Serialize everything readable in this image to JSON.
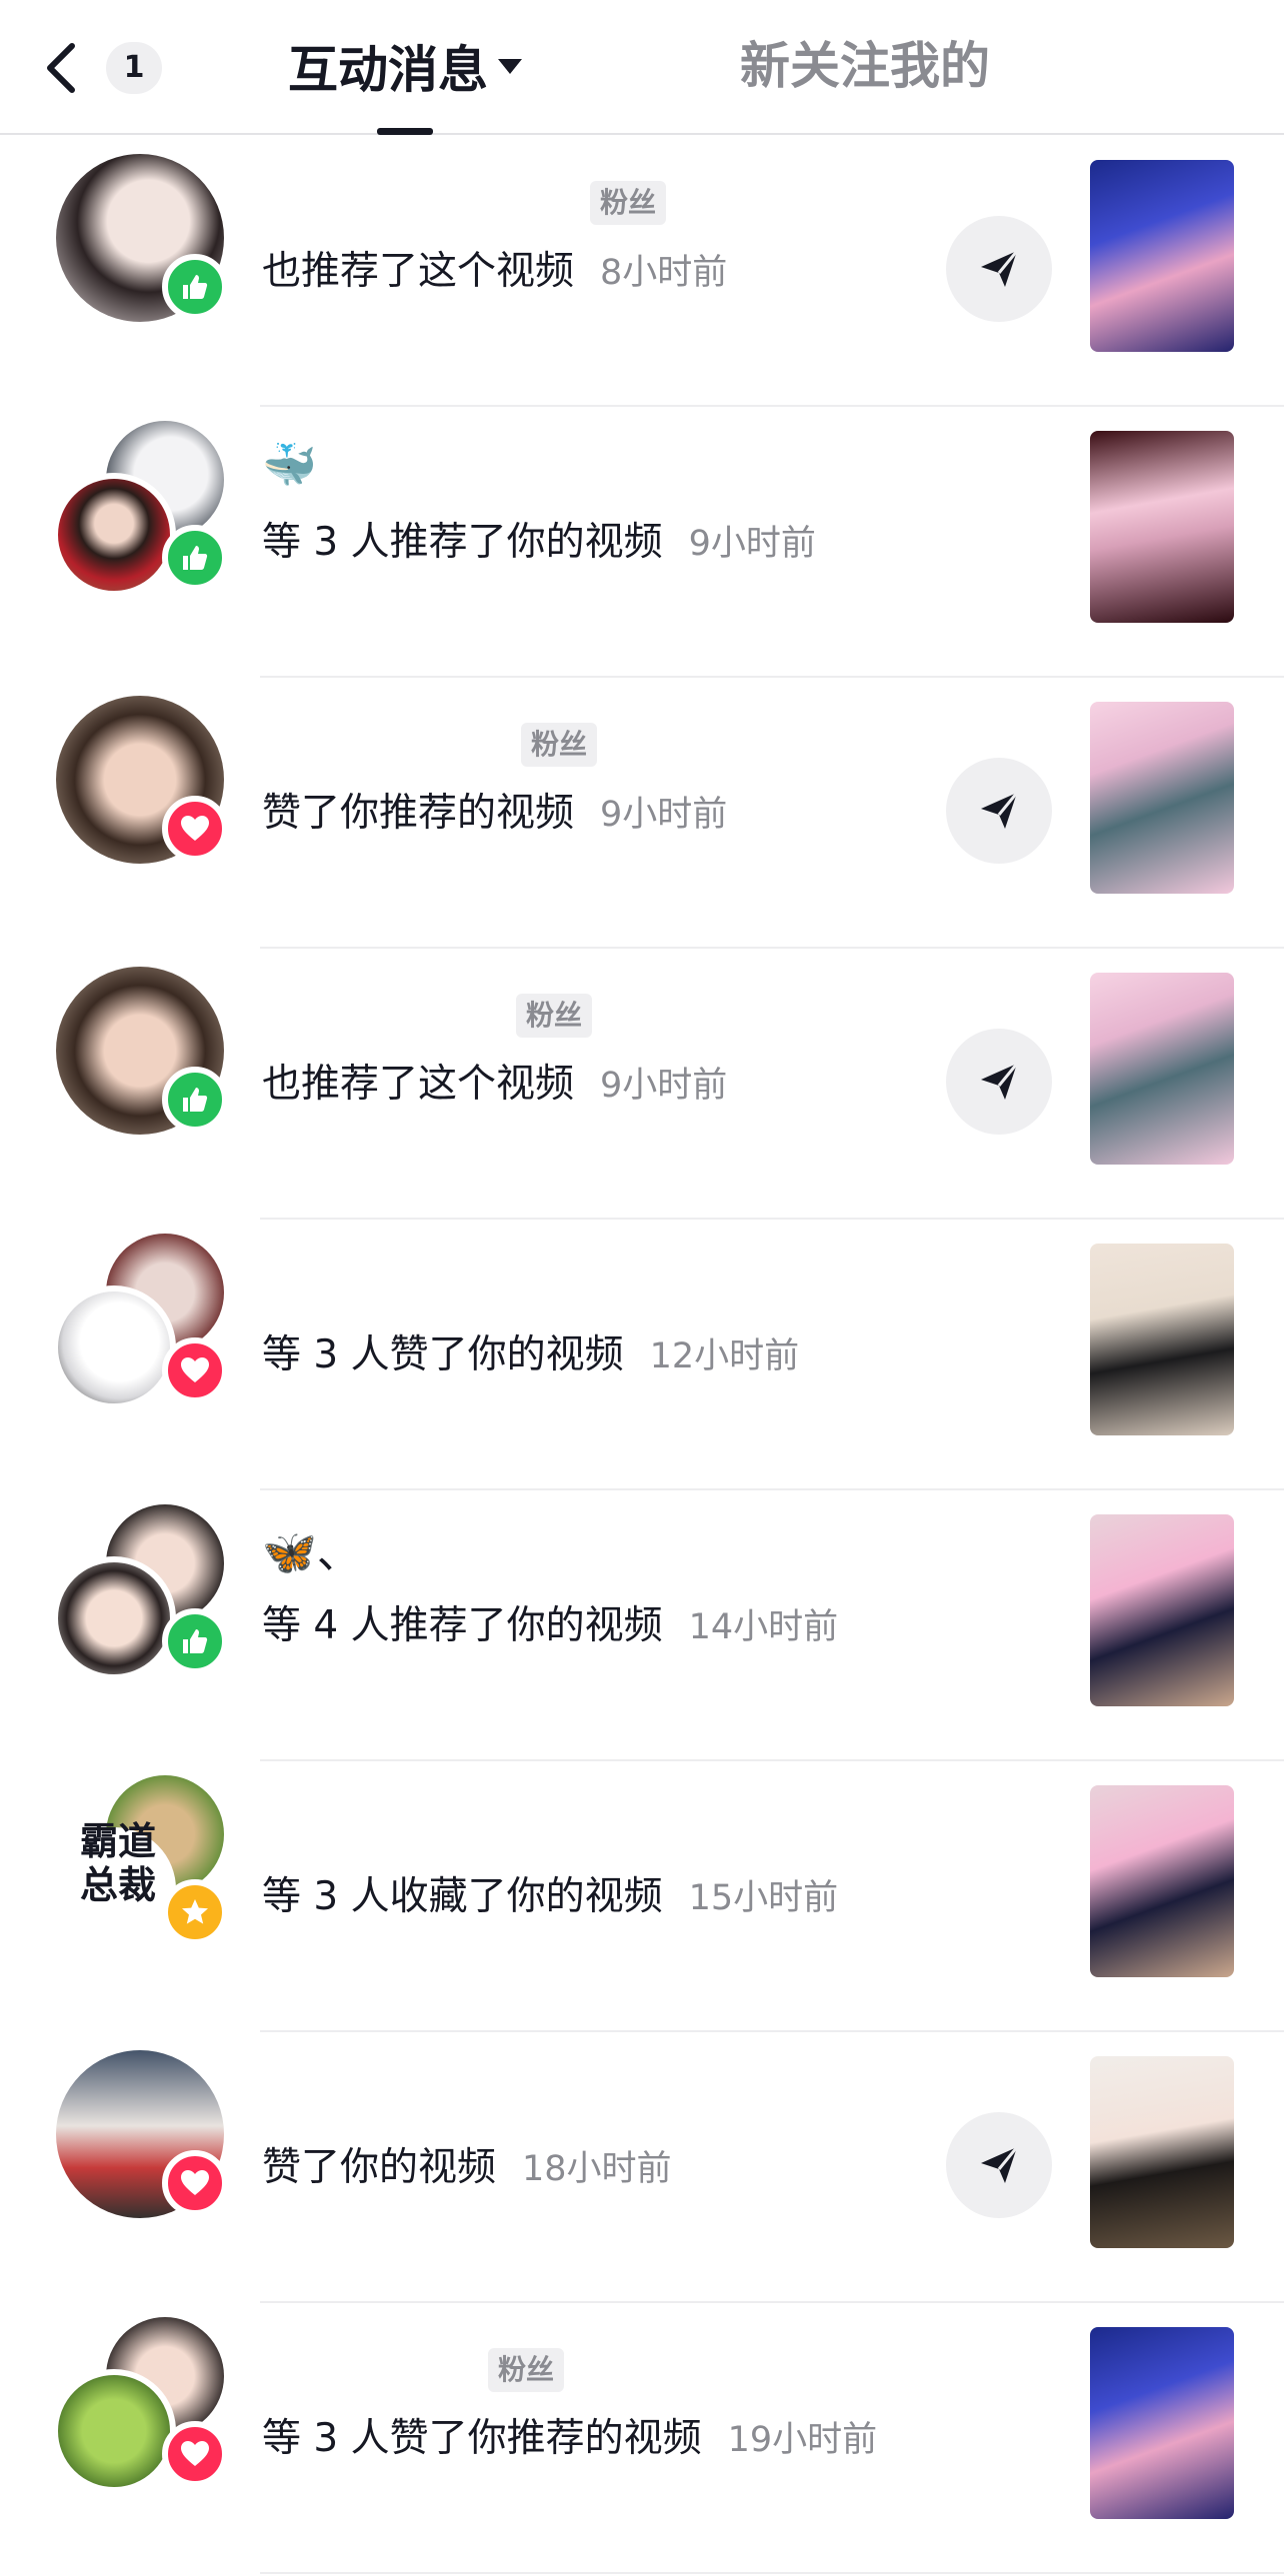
{
  "header": {
    "unread_count": "1",
    "active_tab": "互动消息",
    "other_tab": "新关注我的"
  },
  "fan_label": "粉丝",
  "notifications": [
    {
      "name_text": "",
      "has_fan_tag": true,
      "action": "也推荐了这个视频",
      "time": "8小时前",
      "reaction": "like",
      "has_share": true
    },
    {
      "name_text": "🐳",
      "has_fan_tag": false,
      "action": "等 3 人推荐了你的视频",
      "time": "9小时前",
      "reaction": "like",
      "has_share": false
    },
    {
      "name_text": "",
      "has_fan_tag": true,
      "action": "赞了你推荐的视频",
      "time": "9小时前",
      "reaction": "heart",
      "has_share": true
    },
    {
      "name_text": "",
      "has_fan_tag": true,
      "action": "也推荐了这个视频",
      "time": "9小时前",
      "reaction": "like",
      "has_share": true
    },
    {
      "name_text": "",
      "has_fan_tag": false,
      "action": "等 3 人赞了你的视频",
      "time": "12小时前",
      "reaction": "heart",
      "has_share": false
    },
    {
      "name_text": "🦋、",
      "has_fan_tag": false,
      "action": "等 4 人推荐了你的视频",
      "time": "14小时前",
      "reaction": "like",
      "has_share": false
    },
    {
      "name_text": "",
      "has_fan_tag": false,
      "action": "等 3 人收藏了你的视频",
      "time": "15小时前",
      "reaction": "star",
      "has_share": false,
      "avatar_text": "霸道总裁"
    },
    {
      "name_text": "",
      "has_fan_tag": false,
      "action": "赞了你的视频",
      "time": "18小时前",
      "reaction": "heart",
      "has_share": true
    },
    {
      "name_text": "",
      "has_fan_tag": true,
      "action": "等 3 人赞了你推荐的视频",
      "time": "19小时前",
      "reaction": "heart",
      "has_share": false
    }
  ],
  "colors": {
    "like": "#25c05a",
    "heart": "#fe2c55",
    "star": "#fbb31b",
    "primary_text": "#161823",
    "secondary_text": "#8a8b91"
  }
}
